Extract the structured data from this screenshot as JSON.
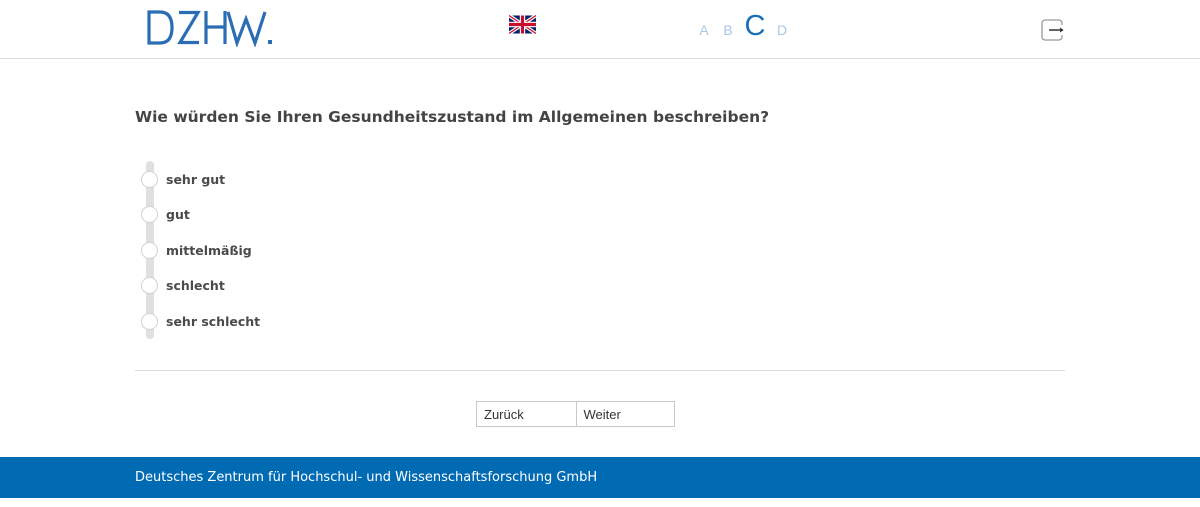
{
  "header": {
    "logo_text": "DZHW.",
    "language_flag": "uk-flag-icon",
    "versions": [
      {
        "label": "A",
        "active": false
      },
      {
        "label": "B",
        "active": false
      },
      {
        "label": "C",
        "active": true
      },
      {
        "label": "D",
        "active": false
      }
    ],
    "logout_icon": "logout-icon"
  },
  "question": {
    "text": "Wie würden Sie Ihren Gesundheitszustand im Allgemeinen beschreiben?",
    "options": [
      {
        "label": "sehr gut"
      },
      {
        "label": "gut"
      },
      {
        "label": "mittelmäßig"
      },
      {
        "label": "schlecht"
      },
      {
        "label": "sehr schlecht"
      }
    ]
  },
  "navigation": {
    "back_label": "Zurück",
    "next_label": "Weiter"
  },
  "footer": {
    "text": "Deutsches Zentrum für Hochschul- und Wissenschaftsforschung GmbH"
  },
  "colors": {
    "brand_blue": "#006ab3",
    "logo_blue": "#2a6db5",
    "version_inactive": "#a8c8e8",
    "version_active": "#1b6fb5"
  }
}
